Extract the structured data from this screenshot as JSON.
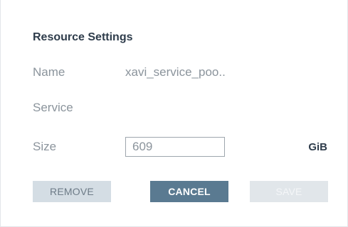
{
  "dialog": {
    "title": "Resource Settings",
    "fields": {
      "name_label": "Name",
      "name_value": "xavi_service_poo..",
      "service_label": "Service",
      "service_value": "",
      "size_label": "Size",
      "size_value": "609",
      "size_unit": "GiB"
    },
    "buttons": {
      "remove": "REMOVE",
      "cancel": "CANCEL",
      "save": "SAVE"
    },
    "colors": {
      "title": "#2e3c4b",
      "label": "#8b949c",
      "cancel_button": "#5a7a91",
      "remove_button": "#d4dde4",
      "save_button_disabled": "#e1e6ea"
    }
  }
}
